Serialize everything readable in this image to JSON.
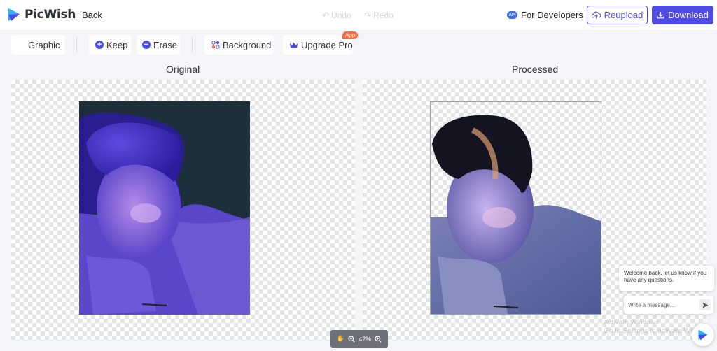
{
  "header": {
    "brand": "PicWish",
    "back_label": "Back",
    "undo_label": "Undo",
    "redo_label": "Redo",
    "dev_label": "For Developers",
    "api_badge": "API",
    "reupload_label": "Reupload",
    "download_label": "Download"
  },
  "toolbar": {
    "graphic_label": "Graphic",
    "keep_label": "Keep",
    "erase_label": "Erase",
    "background_label": "Background",
    "upgrade_label": "Upgrade Pro",
    "app_badge": "App"
  },
  "panels": {
    "original_label": "Original",
    "processed_label": "Processed"
  },
  "zoom": {
    "level": "42%"
  },
  "chat": {
    "message": "Welcome back, let us know if you have any questions.",
    "placeholder": "Write a message..."
  },
  "watermark": {
    "line1": "Activate Windows",
    "line2": "Go to Settings to activate Windows."
  },
  "colors": {
    "accent": "#4f4ce6",
    "badge": "#ff6a3d"
  }
}
